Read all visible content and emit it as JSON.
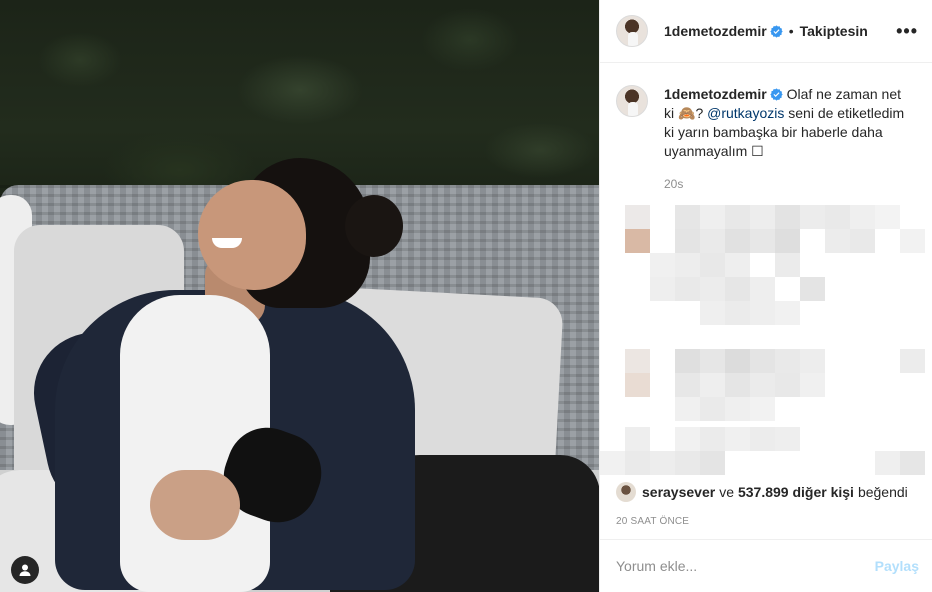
{
  "post": {
    "username": "1demetozdemir",
    "follow_status": "Takiptesin",
    "dot": "•",
    "more": "•••",
    "caption_line1": "Olaf ne zaman net ki",
    "caption_emoji": "🙈?",
    "caption_mention": "@rutkayozis",
    "caption_line2": " seni de etiketledim ki yarın bambaşka bir haberle daha uyanmayalım",
    "caption_end_glyph": "☐",
    "caption_time": "20s",
    "liked_by_user": "seraysever",
    "liked_connector": "ve",
    "liked_count": "537.899 diğer kişi",
    "liked_suffix": "beğendi",
    "date": "20 SAAT ÖNCE"
  },
  "comment": {
    "placeholder": "Yorum ekle...",
    "share_label": "Paylaş"
  },
  "icons": {
    "verified": "verified-badge-icon",
    "photo_user_tag": "user-tag-icon",
    "more": "more-options-icon"
  },
  "colors": {
    "mention": "#00376b",
    "verified": "#3897f0",
    "share_disabled": "#b2dffc",
    "muted": "#8e8e8e"
  }
}
